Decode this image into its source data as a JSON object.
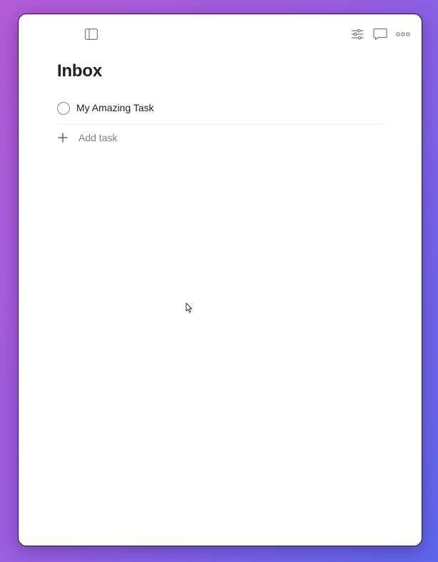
{
  "toolbar": {
    "left_icons": [
      "sidebar-toggle-icon"
    ],
    "right_icons": [
      "filter-sliders-icon",
      "comment-icon",
      "more-icon"
    ]
  },
  "page": {
    "title": "Inbox"
  },
  "tasks": [
    {
      "text": "My Amazing Task",
      "completed": false
    }
  ],
  "add_task": {
    "label": "Add task"
  },
  "colors": {
    "title": "#202020",
    "muted": "#808080",
    "divider": "#eeeeee"
  }
}
